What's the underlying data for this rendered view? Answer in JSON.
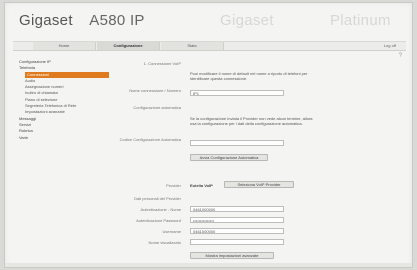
{
  "brand": {
    "name": "Gigaset",
    "model": "A580 IP"
  },
  "faded_labels": [
    "Gigaset",
    "Platinum"
  ],
  "tabs": [
    {
      "label": "Home",
      "active": false
    },
    {
      "label": "Configurazione",
      "active": true
    },
    {
      "label": "Stato",
      "active": false
    }
  ],
  "header": {
    "logout": "Log off",
    "help": "?"
  },
  "sidebar": [
    {
      "label": "Configurazione IP",
      "level": 1,
      "selected": false
    },
    {
      "label": "Telefonia",
      "level": 1,
      "selected": false
    },
    {
      "label": "Connessioni",
      "level": 2,
      "selected": true
    },
    {
      "label": "Audio",
      "level": 2,
      "selected": false
    },
    {
      "label": "Assegnazione numeri",
      "level": 2,
      "selected": false
    },
    {
      "label": "Inoltro di chiamata",
      "level": 2,
      "selected": false
    },
    {
      "label": "Piano di selezione",
      "level": 2,
      "selected": false
    },
    {
      "label": "Segreteria Telefonica di Rete",
      "level": 2,
      "selected": false
    },
    {
      "label": "Impostazioni avanzate",
      "level": 2,
      "selected": false
    },
    {
      "label": "Messaggi",
      "level": 1,
      "selected": false
    },
    {
      "label": "Servizi",
      "level": 1,
      "selected": false
    },
    {
      "label": "Rubrica",
      "level": 1,
      "selected": false
    },
    {
      "label": "Varie",
      "level": 1,
      "selected": false
    }
  ],
  "form": {
    "section_title": "1. Connessione VoIP",
    "intro_text": "Puoi modificare il nome di default nel nome a riporto di telefoni per identificare questa connessione.",
    "connection_name_label": "Nome connessione / Numero",
    "connection_name_value": "IP1",
    "auto_config_title": "Configurazione automatica",
    "auto_config_text": "Se la configurazione inviata il Provider non vede alcun termine, allora usa la configurazione per i dati della configurazione automatica.",
    "auto_config_code_label": "Codice Configurazione Automatica",
    "auto_config_code_value": "",
    "start_auto_config_button": "Avvia Configurazione Automatica",
    "provider_label": "Provider",
    "provider_value": "Eutelia VoIP",
    "select_provider_button": "Seleziona VoIP Provider",
    "personal_data_label": "Dati personali del Provider",
    "auth_name_label": "Autenticazione - Nome",
    "auth_name_value": "0461000000",
    "auth_password_label": "Autenticazione Password",
    "auth_password_value": "•••••••••••••••",
    "username_label": "Username",
    "username_value": "0461000000",
    "display_name_label": "Nome visualizzato",
    "display_name_value": "",
    "general_settings_button": "Mostra impostazioni avanzate"
  }
}
